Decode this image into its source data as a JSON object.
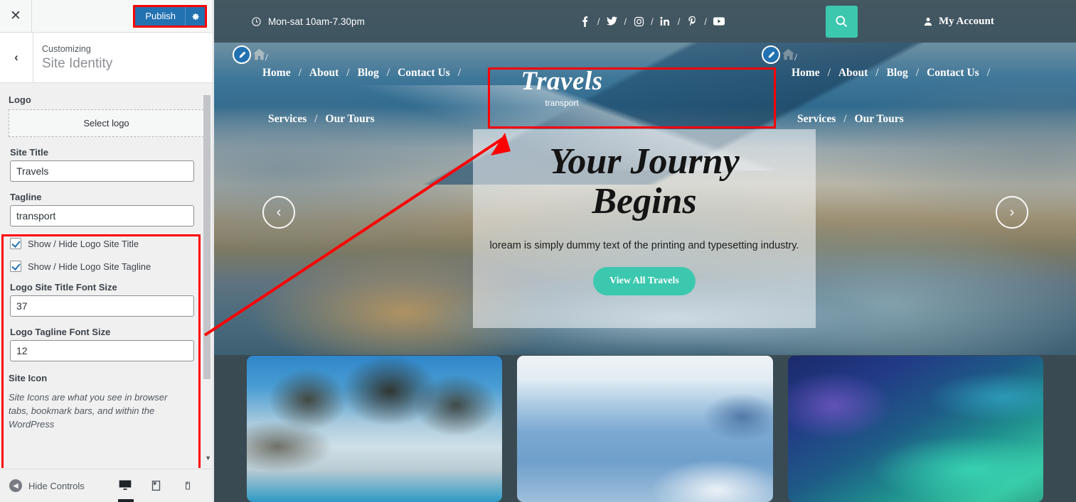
{
  "customizer": {
    "close_icon": "close-icon",
    "publish_label": "Publish",
    "gear_icon": "gear-icon",
    "back_icon": "chevron-left-icon",
    "kicker": "Customizing",
    "panel_title": "Site Identity",
    "logo_section_label": "Logo",
    "select_logo_label": "Select logo",
    "fields": [
      {
        "label": "Site Title",
        "value": "Travels"
      },
      {
        "label": "Tagline",
        "value": "transport"
      }
    ],
    "checkboxes": [
      {
        "label": "Show / Hide Logo Site Title",
        "checked": true
      },
      {
        "label": "Show / Hide Logo Site Tagline",
        "checked": true
      }
    ],
    "number_fields": [
      {
        "label": "Logo Site Title Font Size",
        "value": "37"
      },
      {
        "label": "Logo Tagline Font Size",
        "value": "12"
      }
    ],
    "site_icon_label": "Site Icon",
    "site_icon_description": "Site Icons are what you see in browser tabs, bookmark bars, and within the WordPress",
    "footer": {
      "hide_controls_label": "Hide Controls",
      "devices": [
        {
          "name": "desktop",
          "active": true
        },
        {
          "name": "tablet",
          "active": false
        },
        {
          "name": "mobile",
          "active": false
        }
      ]
    },
    "highlight_color": "#ff0000",
    "publish_color": "#2271b1"
  },
  "preview": {
    "topbar": {
      "clock_icon": "clock-icon",
      "hours": "Mon-sat 10am-7.30pm",
      "social": [
        {
          "icon": "facebook-icon",
          "glyph": "f"
        },
        {
          "icon": "twitter-icon",
          "glyph": "🐦"
        },
        {
          "icon": "instagram-icon",
          "glyph": "▢"
        },
        {
          "icon": "linkedin-icon",
          "glyph": "in"
        },
        {
          "icon": "pinterest-icon",
          "glyph": "P"
        },
        {
          "icon": "youtube-icon",
          "glyph": "▶"
        }
      ],
      "separator": "/",
      "search_icon": "search-icon",
      "account_icon": "person-icon",
      "account_label": "My Account",
      "search_button_color": "#3cc8ae"
    },
    "nav": {
      "row1": [
        "Home",
        "About",
        "Blog",
        "Contact Us"
      ],
      "row2": [
        "Services",
        "Our Tours"
      ],
      "separator": "/",
      "pencil_icon": "pencil-edit-icon",
      "home_icon": "home-icon"
    },
    "brand": {
      "title": "Travels",
      "tagline": "transport",
      "title_font_size": "37",
      "tagline_font_size": "12"
    },
    "hero": {
      "heading_line1": "Your Journy",
      "heading_line2": "Begins",
      "paragraph": "loream is simply dummy text of the printing and typesetting industry.",
      "button_label": "View All Travels",
      "button_color": "#3cc8ae",
      "prev_icon": "chevron-left-icon",
      "next_icon": "chevron-right-icon"
    },
    "cards": [
      {
        "name": "palm-beach-card"
      },
      {
        "name": "santorini-coast-card"
      },
      {
        "name": "aurora-card"
      }
    ]
  }
}
